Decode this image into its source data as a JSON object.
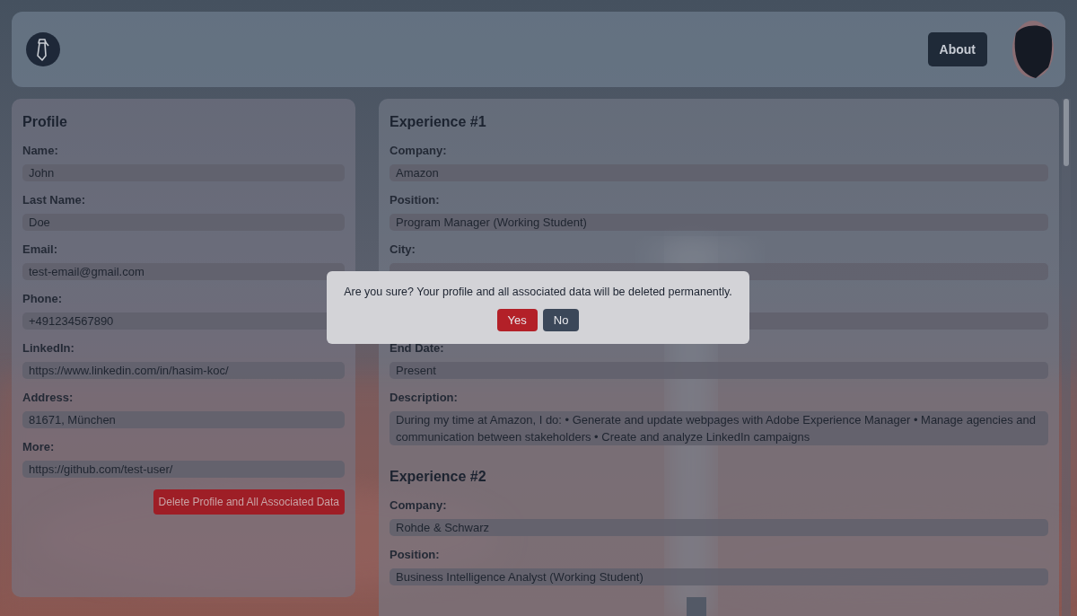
{
  "header": {
    "nav": [
      {
        "label": "About"
      }
    ]
  },
  "profile": {
    "title": "Profile",
    "fields": [
      {
        "label": "Name:",
        "value": "John"
      },
      {
        "label": "Last Name:",
        "value": "Doe"
      },
      {
        "label": "Email:",
        "value": "test-email@gmail.com"
      },
      {
        "label": "Phone:",
        "value": "+491234567890"
      },
      {
        "label": "LinkedIn:",
        "value": "https://www.linkedin.com/in/hasim-koc/"
      },
      {
        "label": "Address:",
        "value": "81671, München"
      },
      {
        "label": "More:",
        "value": "https://github.com/test-user/"
      }
    ],
    "delete_button": "Delete Profile and All Associated Data"
  },
  "experiences": [
    {
      "title": "Experience #1",
      "fields": [
        {
          "kind": "labeled",
          "label": "Company:",
          "value": "Amazon"
        },
        {
          "kind": "labeled",
          "label": "Position:",
          "value": "Program Manager (Working Student)"
        },
        {
          "kind": "labeled",
          "label": "City:"
        },
        {
          "kind": "unlabeled"
        },
        {
          "kind": "labeled",
          "label": "End Date:",
          "value": "Present"
        },
        {
          "kind": "labeled",
          "label": "Description:",
          "value": "During my time at Amazon, I do: • Generate and update webpages with Adobe Experience Manager • Manage agencies and communication between stakeholders • Create and analyze LinkedIn campaigns"
        }
      ]
    },
    {
      "title": "Experience #2",
      "fields": [
        {
          "kind": "labeled",
          "label": "Company:",
          "value": "Rohde & Schwarz"
        },
        {
          "kind": "labeled",
          "label": "Position:",
          "value": "Business Intelligence Analyst (Working Student)"
        }
      ]
    }
  ],
  "dialog": {
    "message": "Are you sure? Your profile and all associated data will be deleted permanently.",
    "buttons": [
      {
        "label": "Yes",
        "kind": "danger"
      },
      {
        "label": "No",
        "kind": "neutral"
      }
    ]
  }
}
